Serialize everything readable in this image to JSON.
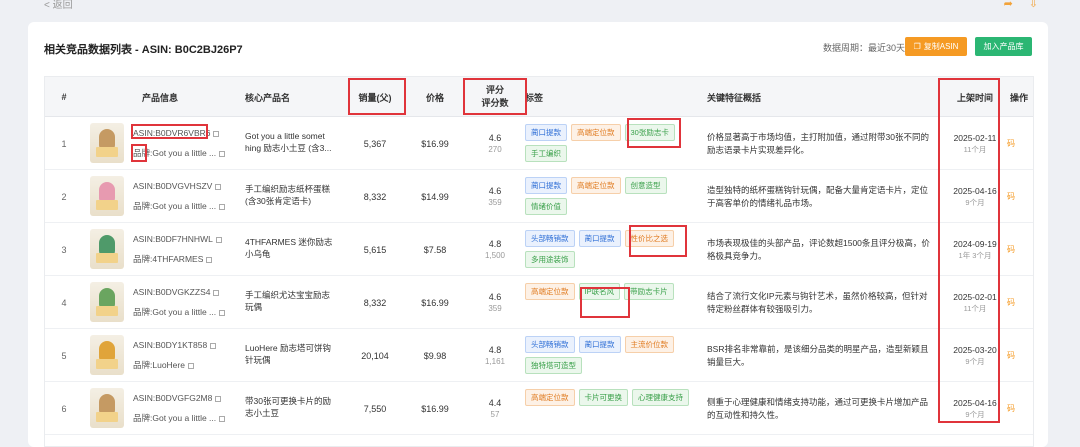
{
  "topbar": {
    "back_label": "< 返回",
    "icons": [
      "share-icon",
      "download-icon"
    ]
  },
  "header": {
    "title": "相关竞品数据列表 - ASIN: B0C2BJ26P7",
    "period": "数据周期：最近30天",
    "copy_label": "复制ASIN",
    "add_label": "加入产品库"
  },
  "columns": {
    "index": "#",
    "product": "产品信息",
    "core": "核心产品名",
    "sales": "销量(父)",
    "price": "价格",
    "rating": "评分",
    "rating_count": "评分数",
    "tags": "标签",
    "feature": "关键特征概括",
    "date": "上架时间",
    "op": "操作"
  },
  "rows": [
    {
      "index": "1",
      "asin": "ASIN:B0DVR6VBR6",
      "brand": "品牌:Got you a little ...",
      "core": "Got you a little somet hing 励志小土豆 (含3...",
      "sales": "5,367",
      "price": "$16.99",
      "rating": "4.6",
      "count": "270",
      "tags": [
        {
          "text": "蔺口提款",
          "c": "blue"
        },
        {
          "text": "高端定位款",
          "c": "orange"
        },
        {
          "text": "30张励志卡",
          "c": "green"
        },
        {
          "text": "手工编织",
          "c": "green"
        }
      ],
      "feature": "价格显著高于市场均值，主打附加值，通过附带30张不同的励志语录卡片实现差异化。",
      "date": "2025-02-11",
      "ago": "11个月",
      "op": "码"
    },
    {
      "index": "2",
      "asin": "ASIN:B0DVGVHSZV",
      "brand": "品牌:Got you a little ...",
      "core": "手工编织励志纸杯蛋糕 (含30张肯定语卡)",
      "sales": "8,332",
      "price": "$14.99",
      "rating": "4.6",
      "count": "359",
      "tags": [
        {
          "text": "蔺口提款",
          "c": "blue"
        },
        {
          "text": "高端定位款",
          "c": "orange"
        },
        {
          "text": "创意造型",
          "c": "green"
        },
        {
          "text": "情绪价值",
          "c": "green"
        }
      ],
      "feature": "造型独特的纸杯蛋糕钩针玩偶，配备大量肯定语卡片，定位于高客单价的情绪礼品市场。",
      "date": "2025-04-16",
      "ago": "9个月",
      "op": "码"
    },
    {
      "index": "3",
      "asin": "ASIN:B0DF7HNHWL",
      "brand": "品牌:4THFARMES",
      "core": "4THFARMES 迷你励志小乌龟",
      "sales": "5,615",
      "price": "$7.58",
      "rating": "4.8",
      "count": "1,500",
      "tags": [
        {
          "text": "头部畅销款",
          "c": "blue"
        },
        {
          "text": "蔺口提款",
          "c": "blue"
        },
        {
          "text": "性价比之选",
          "c": "orange"
        },
        {
          "text": "多用途装饰",
          "c": "green"
        }
      ],
      "feature": "市场表现极佳的头部产品，评论数超1500条且评分极高，价格极具竞争力。",
      "date": "2024-09-19",
      "ago": "1年 3个月",
      "op": "码"
    },
    {
      "index": "4",
      "asin": "ASIN:B0DVGKZZS4",
      "brand": "品牌:Got you a little ...",
      "core": "手工编织尤达宝宝励志玩偶",
      "sales": "8,332",
      "price": "$16.99",
      "rating": "4.6",
      "count": "359",
      "tags": [
        {
          "text": "高端定位款",
          "c": "orange"
        },
        {
          "text": "IP联名风",
          "c": "green"
        },
        {
          "text": "带励志卡片",
          "c": "green"
        }
      ],
      "feature": "结合了流行文化IP元素与钩针艺术，虽然价格较高，但针对特定粉丝群体有较强吸引力。",
      "date": "2025-02-01",
      "ago": "11个月",
      "op": "码"
    },
    {
      "index": "5",
      "asin": "ASIN:B0DY1KT858",
      "brand": "品牌:LuoHere",
      "core": "LuoHere 励志塔可饼钩针玩偶",
      "sales": "20,104",
      "price": "$9.98",
      "rating": "4.8",
      "count": "1,161",
      "tags": [
        {
          "text": "头部畅销款",
          "c": "blue"
        },
        {
          "text": "蔺口提款",
          "c": "blue"
        },
        {
          "text": "主流价位款",
          "c": "orange"
        },
        {
          "text": "独特塔可造型",
          "c": "green"
        }
      ],
      "feature": "BSR排名非常靠前，是该细分品类的明星产品，造型新颖且销量巨大。",
      "date": "2025-03-20",
      "ago": "9个月",
      "op": "码"
    },
    {
      "index": "6",
      "asin": "ASIN:B0DVGFG2M8",
      "brand": "品牌:Got you a little ...",
      "core": "带30张可更换卡片的励志小土豆",
      "sales": "7,550",
      "price": "$16.99",
      "rating": "4.4",
      "count": "57",
      "tags": [
        {
          "text": "高端定位款",
          "c": "orange"
        },
        {
          "text": "卡片可更换",
          "c": "green"
        },
        {
          "text": "心理健康支持",
          "c": "green"
        }
      ],
      "feature": "侧重于心理健康和情绪支持功能，通过可更换卡片增加产品的互动性和持久性。",
      "date": "2025-04-16",
      "ago": "9个月",
      "op": "码"
    }
  ],
  "thumb_colors": [
    "#c59a63",
    "#e79ab0",
    "#4f9a6a",
    "#6aa560",
    "#e0a43a",
    "#c59a63"
  ]
}
